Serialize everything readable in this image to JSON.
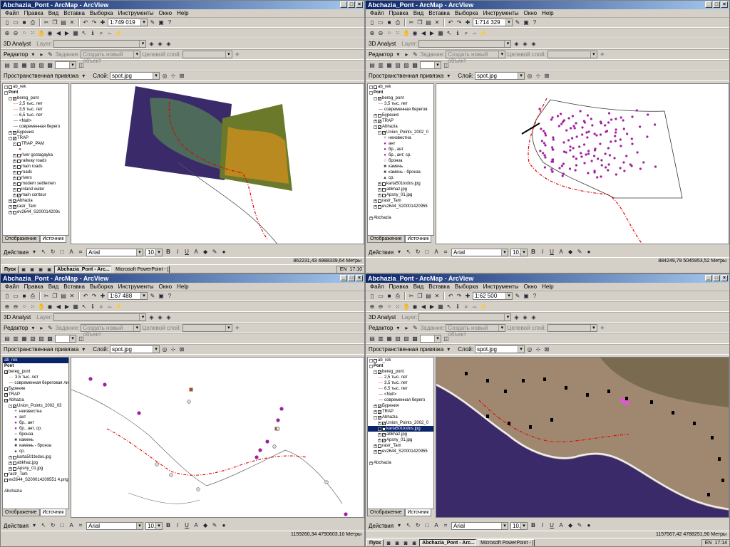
{
  "windows": [
    {
      "title": "Abchazia_Pont - ArcMap - ArcView",
      "scale": "1:749 019",
      "layers": [
        {
          "label": "ab_rek",
          "level": 0,
          "chk": false,
          "exp": "-",
          "bold": false,
          "sym": ""
        },
        {
          "label": "Pont",
          "level": 0,
          "chk": null,
          "exp": "-",
          "bold": true,
          "sym": ""
        },
        {
          "label": "bereg_pont",
          "level": 1,
          "chk": true,
          "exp": "-",
          "bold": false,
          "sym": ""
        },
        {
          "label": "2,5 тыс. лет",
          "level": 2,
          "chk": null,
          "exp": "",
          "bold": false,
          "sym": "-·-"
        },
        {
          "label": "3,5 тыс. лет",
          "level": 2,
          "chk": null,
          "exp": "",
          "bold": false,
          "sym": "-·-"
        },
        {
          "label": "6,5 тыс. лет",
          "level": 2,
          "chk": null,
          "exp": "",
          "bold": false,
          "sym": "-·-"
        },
        {
          "label": "<Null>",
          "level": 2,
          "chk": null,
          "exp": "",
          "bold": false,
          "sym": "—"
        },
        {
          "label": "современная берего",
          "level": 2,
          "chk": null,
          "exp": "",
          "bold": false,
          "sym": "—"
        },
        {
          "label": "Бурения",
          "level": 1,
          "chk": true,
          "exp": "+",
          "bold": false,
          "sym": ""
        },
        {
          "label": "TRAP",
          "level": 1,
          "chk": true,
          "exp": "-",
          "bold": false,
          "sym": ""
        },
        {
          "label": "TRAP_PAM",
          "level": 2,
          "chk": false,
          "exp": "-",
          "bold": false,
          "sym": ""
        },
        {
          "label": "",
          "level": 3,
          "chk": null,
          "exp": "",
          "bold": false,
          "sym": "●"
        },
        {
          "label": "river gostagayka",
          "level": 2,
          "chk": false,
          "exp": "+",
          "bold": false,
          "sym": ""
        },
        {
          "label": "railway roads",
          "level": 2,
          "chk": false,
          "exp": "+",
          "bold": false,
          "sym": ""
        },
        {
          "label": "main roads",
          "level": 2,
          "chk": false,
          "exp": "+",
          "bold": false,
          "sym": ""
        },
        {
          "label": "roads",
          "level": 2,
          "chk": false,
          "exp": "+",
          "bold": false,
          "sym": ""
        },
        {
          "label": "rivers",
          "level": 2,
          "chk": false,
          "exp": "+",
          "bold": false,
          "sym": ""
        },
        {
          "label": "modern settlemen",
          "level": 2,
          "chk": false,
          "exp": "+",
          "bold": false,
          "sym": ""
        },
        {
          "label": "inland water",
          "level": 2,
          "chk": false,
          "exp": "+",
          "bold": false,
          "sym": ""
        },
        {
          "label": "main contour",
          "level": 2,
          "chk": true,
          "exp": "+",
          "bold": false,
          "sym": ""
        },
        {
          "label": "Abhazia",
          "level": 1,
          "chk": true,
          "exp": "+",
          "bold": false,
          "sym": ""
        },
        {
          "label": "rastr_Tam",
          "level": 1,
          "chk": true,
          "exp": "+",
          "bold": false,
          "sym": ""
        },
        {
          "label": "ev2644_S200014209s",
          "level": 1,
          "chk": false,
          "exp": "+",
          "bold": false,
          "sym": ""
        }
      ],
      "coords": "862231,43  4988339,64 Метры",
      "tasks": [
        {
          "label": "Abchazia_Pont - Arc...",
          "on": true
        },
        {
          "label": "Microsoft PowerPoint - [...",
          "on": false
        }
      ],
      "clock": "17:10"
    },
    {
      "title": "Abchazia_Pont - ArcMap - ArcView",
      "scale": "1:714 329",
      "layers": [
        {
          "label": "ab_rek",
          "level": 0,
          "chk": false,
          "exp": "-",
          "bold": false,
          "sym": ""
        },
        {
          "label": "Pont",
          "level": 0,
          "chk": null,
          "exp": "-",
          "bold": true,
          "sym": ""
        },
        {
          "label": "bereg_pont",
          "level": 1,
          "chk": true,
          "exp": "-",
          "bold": false,
          "sym": ""
        },
        {
          "label": "3,5 тыс. лет",
          "level": 2,
          "chk": null,
          "exp": "",
          "bold": false,
          "sym": "-·-"
        },
        {
          "label": "современная берегов",
          "level": 2,
          "chk": null,
          "exp": "",
          "bold": false,
          "sym": "—"
        },
        {
          "label": "Бурения",
          "level": 1,
          "chk": false,
          "exp": "+",
          "bold": false,
          "sym": ""
        },
        {
          "label": "TRAP",
          "level": 1,
          "chk": true,
          "exp": "+",
          "bold": false,
          "sym": ""
        },
        {
          "label": "Abhazia",
          "level": 1,
          "chk": true,
          "exp": "-",
          "bold": false,
          "sym": ""
        },
        {
          "label": "Union_Points_2002_0",
          "level": 2,
          "chk": true,
          "exp": "-",
          "bold": false,
          "sym": ""
        },
        {
          "label": "неизвестна",
          "level": 3,
          "chk": null,
          "exp": "",
          "bold": false,
          "sym": "+"
        },
        {
          "label": "ант",
          "level": 3,
          "chk": null,
          "exp": "",
          "bold": false,
          "sym": "●"
        },
        {
          "label": "бр., ант",
          "level": 3,
          "chk": null,
          "exp": "",
          "bold": false,
          "sym": "●"
        },
        {
          "label": "бр., ант, ср.",
          "level": 3,
          "chk": null,
          "exp": "",
          "bold": false,
          "sym": "●"
        },
        {
          "label": "бронза",
          "level": 3,
          "chk": null,
          "exp": "",
          "bold": false,
          "sym": "○"
        },
        {
          "label": "камень",
          "level": 3,
          "chk": null,
          "exp": "",
          "bold": false,
          "sym": "■"
        },
        {
          "label": "камень - бронза",
          "level": 3,
          "chk": null,
          "exp": "",
          "bold": false,
          "sym": "■"
        },
        {
          "label": "ср.",
          "level": 3,
          "chk": null,
          "exp": "",
          "bold": false,
          "sym": "▲"
        },
        {
          "label": "karta501todos.jpg",
          "level": 2,
          "chk": false,
          "exp": "+",
          "bold": false,
          "sym": ""
        },
        {
          "label": "abkhaz.jpg",
          "level": 2,
          "chk": false,
          "exp": "+",
          "bold": false,
          "sym": ""
        },
        {
          "label": "Apsny_01.jpg",
          "level": 2,
          "chk": false,
          "exp": "+",
          "bold": false,
          "sym": ""
        },
        {
          "label": "rastr_Tam",
          "level": 1,
          "chk": false,
          "exp": "+",
          "bold": false,
          "sym": ""
        },
        {
          "label": "ev2644_S20001420955",
          "level": 1,
          "chk": false,
          "exp": "+",
          "bold": false,
          "sym": ""
        },
        {
          "label": "",
          "level": 0,
          "chk": null,
          "exp": "",
          "bold": false,
          "sym": ""
        },
        {
          "label": "Abchazia",
          "level": 0,
          "chk": null,
          "exp": "+",
          "bold": false,
          "sym": ""
        }
      ],
      "coords": "884249,79  5045953,52 Метры",
      "tasks": [],
      "clock": ""
    },
    {
      "title": "Abchazia_Pont - ArcMap - ArcView",
      "scale": "1:67 488",
      "layers": [
        {
          "label": "ab_rek",
          "level": 0,
          "chk": null,
          "exp": "",
          "bold": false,
          "sym": "",
          "sel": true
        },
        {
          "label": "Pont",
          "level": 0,
          "chk": null,
          "exp": "",
          "bold": true,
          "sym": ""
        },
        {
          "label": "bereg_pont",
          "level": 0,
          "chk": true,
          "exp": "",
          "bold": false,
          "sym": ""
        },
        {
          "label": "3,5 тыс. лет",
          "level": 1,
          "chk": null,
          "exp": "",
          "bold": false,
          "sym": "-·-"
        },
        {
          "label": "современная береговая ли",
          "level": 1,
          "chk": null,
          "exp": "",
          "bold": false,
          "sym": "—"
        },
        {
          "label": "Бурение",
          "level": 0,
          "chk": false,
          "exp": "",
          "bold": false,
          "sym": ""
        },
        {
          "label": "TRAP",
          "level": 0,
          "chk": true,
          "exp": "",
          "bold": false,
          "sym": ""
        },
        {
          "label": "Abhazia",
          "level": 0,
          "chk": true,
          "exp": "",
          "bold": false,
          "sym": ""
        },
        {
          "label": "Union_Points_2002_03",
          "level": 1,
          "chk": true,
          "exp": "-",
          "bold": false,
          "sym": ""
        },
        {
          "label": "неизвестна",
          "level": 2,
          "chk": null,
          "exp": "",
          "bold": false,
          "sym": "+"
        },
        {
          "label": "ант",
          "level": 2,
          "chk": null,
          "exp": "",
          "bold": false,
          "sym": "●"
        },
        {
          "label": "бр., ант",
          "level": 2,
          "chk": null,
          "exp": "",
          "bold": false,
          "sym": "●"
        },
        {
          "label": "бр., ант, ср.",
          "level": 2,
          "chk": null,
          "exp": "",
          "bold": false,
          "sym": "●"
        },
        {
          "label": "бронза",
          "level": 2,
          "chk": null,
          "exp": "",
          "bold": false,
          "sym": "○"
        },
        {
          "label": "камень",
          "level": 2,
          "chk": null,
          "exp": "",
          "bold": false,
          "sym": "■"
        },
        {
          "label": "камень - бронза",
          "level": 2,
          "chk": null,
          "exp": "",
          "bold": false,
          "sym": "■"
        },
        {
          "label": "ср.",
          "level": 2,
          "chk": null,
          "exp": "",
          "bold": false,
          "sym": "▲"
        },
        {
          "label": "karta501todos.jpg",
          "level": 1,
          "chk": false,
          "exp": "+",
          "bold": false,
          "sym": ""
        },
        {
          "label": "abkhaz.jpg",
          "level": 1,
          "chk": false,
          "exp": "+",
          "bold": false,
          "sym": ""
        },
        {
          "label": "Apsny_01.jpg",
          "level": 1,
          "chk": false,
          "exp": "+",
          "bold": false,
          "sym": ""
        },
        {
          "label": "rastr_Tam",
          "level": 0,
          "chk": false,
          "exp": "",
          "bold": false,
          "sym": ""
        },
        {
          "label": "ev2644_S200014209551 4.png",
          "level": 0,
          "chk": false,
          "exp": "",
          "bold": false,
          "sym": ""
        },
        {
          "label": "",
          "level": 0,
          "chk": null,
          "exp": "",
          "bold": false,
          "sym": ""
        },
        {
          "label": "Abchazia",
          "level": 0,
          "chk": null,
          "exp": "",
          "bold": false,
          "sym": ""
        }
      ],
      "coords": "1159260,34  4790603,10 Метры",
      "tasks": [],
      "clock": ""
    },
    {
      "title": "Abchazia_Pont - ArcMap - ArcView",
      "scale": "1:62 500",
      "layers": [
        {
          "label": "ab_rek",
          "level": 0,
          "chk": false,
          "exp": "-",
          "bold": false,
          "sym": ""
        },
        {
          "label": "Pont",
          "level": 0,
          "chk": null,
          "exp": "-",
          "bold": true,
          "sym": ""
        },
        {
          "label": "bereg_pont",
          "level": 1,
          "chk": true,
          "exp": "-",
          "bold": false,
          "sym": ""
        },
        {
          "label": "2,5 тыс. лет",
          "level": 2,
          "chk": null,
          "exp": "",
          "bold": false,
          "sym": "-·-"
        },
        {
          "label": "3,5 тыс. лет",
          "level": 2,
          "chk": null,
          "exp": "",
          "bold": false,
          "sym": "-·-"
        },
        {
          "label": "6,5 тыс. лет",
          "level": 2,
          "chk": null,
          "exp": "",
          "bold": false,
          "sym": "-·-"
        },
        {
          "label": "<Null>",
          "level": 2,
          "chk": null,
          "exp": "",
          "bold": false,
          "sym": "—"
        },
        {
          "label": "современная берего",
          "level": 2,
          "chk": null,
          "exp": "",
          "bold": false,
          "sym": "—"
        },
        {
          "label": "Бурения",
          "level": 1,
          "chk": true,
          "exp": "+",
          "bold": false,
          "sym": ""
        },
        {
          "label": "TRAP",
          "level": 1,
          "chk": true,
          "exp": "+",
          "bold": false,
          "sym": ""
        },
        {
          "label": "Abhazia",
          "level": 1,
          "chk": true,
          "exp": "-",
          "bold": false,
          "sym": ""
        },
        {
          "label": "Union_Points_2002_0",
          "level": 2,
          "chk": true,
          "exp": "+",
          "bold": false,
          "sym": ""
        },
        {
          "label": "karta501todos.jpg",
          "level": 2,
          "chk": true,
          "exp": "+",
          "bold": false,
          "sym": "",
          "sel": true
        },
        {
          "label": "abkhaz.jpg",
          "level": 2,
          "chk": true,
          "exp": "+",
          "bold": false,
          "sym": ""
        },
        {
          "label": "Apsny_01.jpg",
          "level": 2,
          "chk": true,
          "exp": "+",
          "bold": false,
          "sym": ""
        },
        {
          "label": "rastr_Tam",
          "level": 1,
          "chk": false,
          "exp": "+",
          "bold": false,
          "sym": ""
        },
        {
          "label": "ev2644_S20001420955",
          "level": 1,
          "chk": false,
          "exp": "+",
          "bold": false,
          "sym": ""
        },
        {
          "label": "",
          "level": 0,
          "chk": null,
          "exp": "",
          "bold": false,
          "sym": ""
        },
        {
          "label": "Abchazia",
          "level": 0,
          "chk": null,
          "exp": "+",
          "bold": false,
          "sym": ""
        }
      ],
      "coords": "1157567,42  4788251,90 Метры",
      "tasks": [
        {
          "label": "Abchazia_Pont - Arc...",
          "on": true
        },
        {
          "label": "Microsoft PowerPoint - [...",
          "on": false
        }
      ],
      "clock": "17:14"
    }
  ],
  "menu": [
    "Файл",
    "Правка",
    "Вид",
    "Вставка",
    "Выборка",
    "Инструменты",
    "Окно",
    "Help"
  ],
  "toolbar_labels": {
    "analyst": "3D Analyst",
    "layer": "Layer:",
    "editor": "Редактор",
    "task": "Задание:",
    "task_value": "Создать новый объект",
    "target": "Целевой слой:",
    "snapping": "Пространственная привязка",
    "layer2": "Слой:",
    "layer2_value": "spot.jpg",
    "actions": "Действия",
    "font": "Arial",
    "fontsize": "10,0",
    "start": "Пуск",
    "toc_tab_display": "Отображение",
    "toc_tab_source": "Источник"
  },
  "colors": {
    "title_start": "#0a246a",
    "title_end": "#a6caf0",
    "point_purple": "#a020a0",
    "shoreline_red": "#e00000",
    "sea_purple": "#3a2a6a"
  }
}
